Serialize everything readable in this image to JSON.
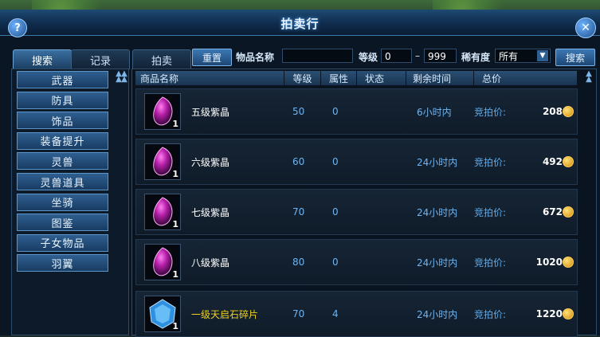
{
  "window": {
    "title": "拍卖行",
    "help_label": "?",
    "close_label": "✕"
  },
  "tabs": [
    {
      "label": "搜索",
      "active": true
    },
    {
      "label": "记录",
      "active": false
    },
    {
      "label": "拍卖",
      "active": false
    }
  ],
  "search": {
    "reset_label": "重置",
    "item_name_label": "物品名称",
    "item_name_value": "",
    "level_label": "等级",
    "level_min": "0",
    "level_sep": "–",
    "level_max": "999",
    "rarity_label": "稀有度",
    "rarity_value": "所有",
    "search_label": "搜索"
  },
  "categories": [
    "武器",
    "防具",
    "饰品",
    "装备提升",
    "灵兽",
    "灵兽道具",
    "坐骑",
    "图鉴",
    "子女物品",
    "羽翼"
  ],
  "columns": [
    "商品名称",
    "等级",
    "属性",
    "状态",
    "剩余时间",
    "总价"
  ],
  "rows": [
    {
      "name": "五级紫晶",
      "level": "50",
      "attr": "0",
      "time": "6小时内",
      "price_label": "竞拍价:",
      "price": "208",
      "qty": "1",
      "icon": "purple-gem-icon",
      "name_color": "#ffffff"
    },
    {
      "name": "六级紫晶",
      "level": "60",
      "attr": "0",
      "time": "24小时内",
      "price_label": "竞拍价:",
      "price": "492",
      "qty": "1",
      "icon": "purple-gem-icon",
      "name_color": "#ffffff"
    },
    {
      "name": "七级紫晶",
      "level": "70",
      "attr": "0",
      "time": "24小时内",
      "price_label": "竞拍价:",
      "price": "672",
      "qty": "1",
      "icon": "purple-gem-icon",
      "name_color": "#ffffff"
    },
    {
      "name": "八级紫晶",
      "level": "80",
      "attr": "0",
      "time": "24小时内",
      "price_label": "竞拍价:",
      "price": "1020",
      "qty": "1",
      "icon": "purple-gem-icon",
      "name_color": "#ffffff"
    },
    {
      "name": "一级天启石碎片",
      "level": "70",
      "attr": "4",
      "time": "24小时内",
      "price_label": "竞拍价:",
      "price": "1220",
      "qty": "1",
      "icon": "blue-crystal-icon",
      "name_color": "#f0d21c"
    }
  ]
}
